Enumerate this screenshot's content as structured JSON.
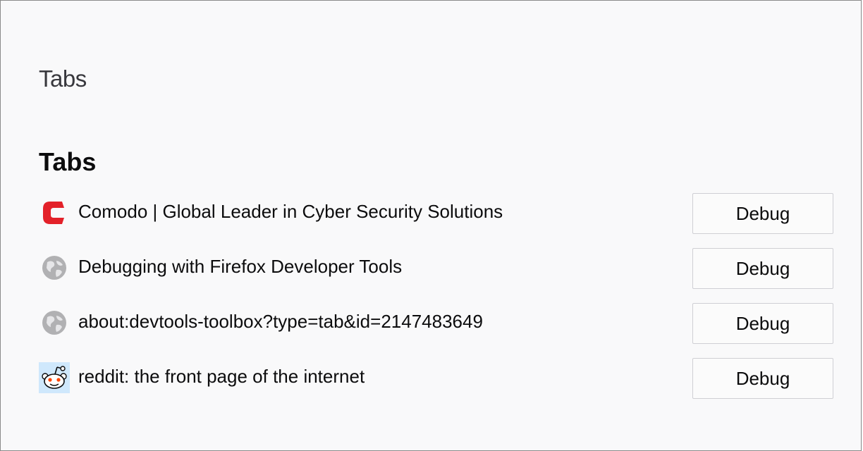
{
  "page": {
    "title": "Tabs"
  },
  "tabs_section": {
    "heading": "Tabs",
    "items": [
      {
        "title": "Comodo | Global Leader in Cyber Security Solutions",
        "icon": "comodo-logo-icon",
        "button_label": "Debug"
      },
      {
        "title": "Debugging with Firefox Developer Tools",
        "icon": "globe-icon",
        "button_label": "Debug"
      },
      {
        "title": "about:devtools-toolbox?type=tab&id=2147483649",
        "icon": "globe-icon",
        "button_label": "Debug"
      },
      {
        "title": "reddit: the front page of the internet",
        "icon": "reddit-alien-icon",
        "button_label": "Debug"
      }
    ]
  },
  "colors": {
    "comodo_red": "#e32129",
    "globe_gray": "#b1b1b3",
    "reddit_highlight": "#cfe8fc",
    "reddit_orange": "#ff4500"
  }
}
